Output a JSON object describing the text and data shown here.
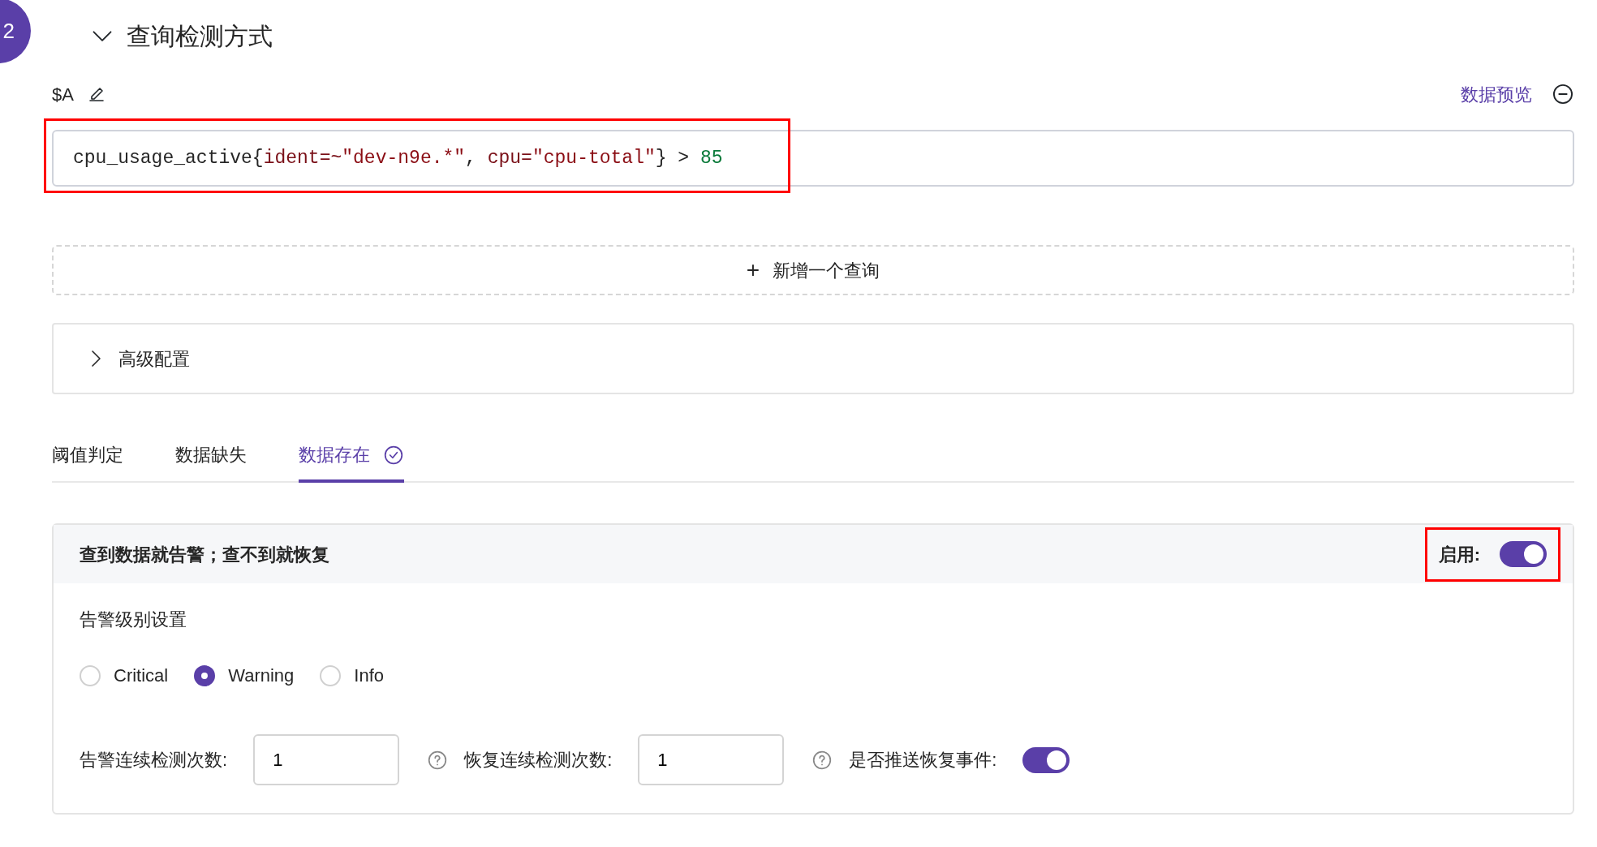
{
  "step": {
    "number": "2",
    "title": "查询检测方式",
    "expanded": true
  },
  "query": {
    "ref": "$A",
    "preview_link": "数据预览",
    "highlighted": true,
    "tokens": [
      {
        "text": "cpu_usage_active{",
        "kind": "plain"
      },
      {
        "text": "ident=~",
        "kind": "label"
      },
      {
        "text": "\"dev-n9e.*\"",
        "kind": "string"
      },
      {
        "text": ", ",
        "kind": "plain"
      },
      {
        "text": "cpu=",
        "kind": "label"
      },
      {
        "text": "\"cpu-total\"",
        "kind": "string"
      },
      {
        "text": "} > ",
        "kind": "plain"
      },
      {
        "text": "85",
        "kind": "number"
      }
    ]
  },
  "add_query": {
    "icon": "+",
    "label": "新增一个查询"
  },
  "advanced": {
    "label": "高级配置",
    "expanded": false
  },
  "tabs": [
    {
      "label": "阈值判定",
      "selected": false,
      "checked": false
    },
    {
      "label": "数据缺失",
      "selected": false,
      "checked": false
    },
    {
      "label": "数据存在",
      "selected": true,
      "checked": true
    }
  ],
  "panel": {
    "title": "查到数据就告警；查不到就恢复",
    "enable_label": "启用:",
    "enabled": true,
    "enable_highlighted": true,
    "severity_label": "告警级别设置",
    "severities": [
      {
        "label": "Critical",
        "selected": false
      },
      {
        "label": "Warning",
        "selected": true
      },
      {
        "label": "Info",
        "selected": false
      }
    ],
    "fields": [
      {
        "kind": "number",
        "label": "告警连续检测次数:",
        "value": "1",
        "help": false
      },
      {
        "kind": "number",
        "label": "恢复连续检测次数:",
        "value": "1",
        "help": true
      },
      {
        "kind": "switch",
        "label": "是否推送恢复事件:",
        "on": true,
        "help": true
      }
    ]
  }
}
